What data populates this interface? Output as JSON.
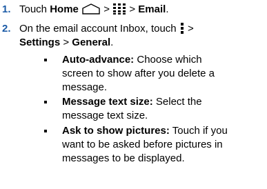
{
  "steps": [
    {
      "number": "1.",
      "parts": {
        "touch": "Touch",
        "home": "Home",
        "sep1": ">",
        "sep2": ">",
        "email": "Email",
        "end": "."
      },
      "icons": [
        "home-outline-icon",
        "app-grid-icon"
      ]
    },
    {
      "number": "2.",
      "parts": {
        "line1": "On the email account Inbox, touch",
        "sep1": ">",
        "settings": "Settings",
        "sep2": ">",
        "general": "General",
        "end": "."
      },
      "icons": [
        "menu-dots-icon"
      ]
    }
  ],
  "bullets": [
    {
      "term": "Auto-advance:",
      "lines": [
        "Choose which",
        "screen to show after you delete a",
        "message."
      ]
    },
    {
      "term": "Message text size:",
      "lines": [
        "Select the",
        "message text size."
      ]
    },
    {
      "term": "Ask to show pictures:",
      "lines": [
        "Touch if you",
        "want to be asked before pictures in",
        "messages to be displayed."
      ]
    }
  ]
}
